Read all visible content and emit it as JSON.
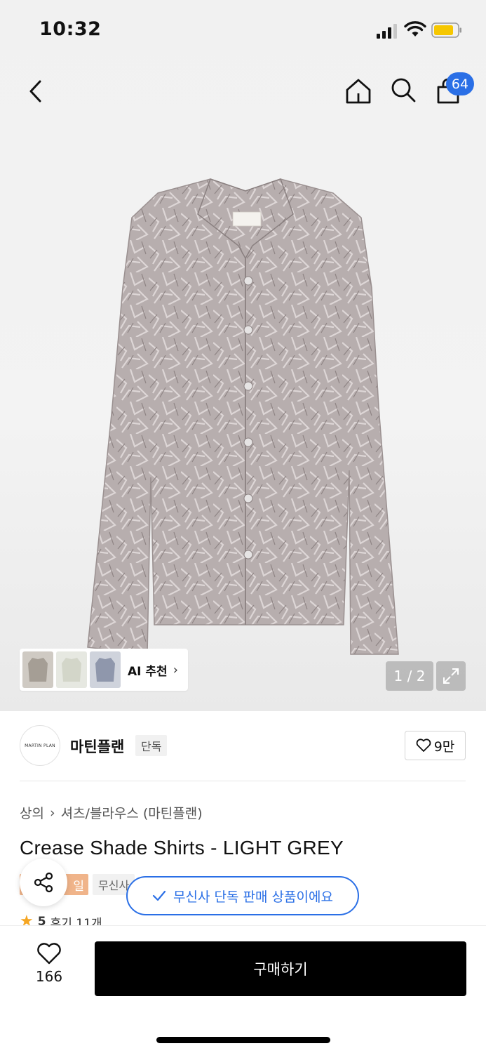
{
  "status_bar": {
    "time": "10:32"
  },
  "nav": {
    "cart_count": "64"
  },
  "hero": {
    "ai_recommend_label": "AI 추천",
    "page_counter": "1 / 2"
  },
  "brand": {
    "logo_text": "MARTIN PLAN",
    "name": "마틴플랜",
    "tag": "단독",
    "like_count": "9만"
  },
  "breadcrumb": {
    "category": "상의",
    "subcategory": "셔츠/블라우스 (마틴플랜)"
  },
  "product": {
    "title": "Crease Shade Shirts - LIGHT GREY",
    "badge_sale": "일",
    "badge_musinsa": "무신사",
    "rating": "5",
    "review_text": "후기 11개"
  },
  "toast": {
    "message": "무신사 단독 판매 상품이에요"
  },
  "bottom": {
    "wish_count": "166",
    "buy_label": "구매하기"
  },
  "colors": {
    "accent": "#2a6fe6",
    "buy_button": "#000000",
    "sale_badge": "#f0b48a",
    "star": "#f5a623"
  }
}
